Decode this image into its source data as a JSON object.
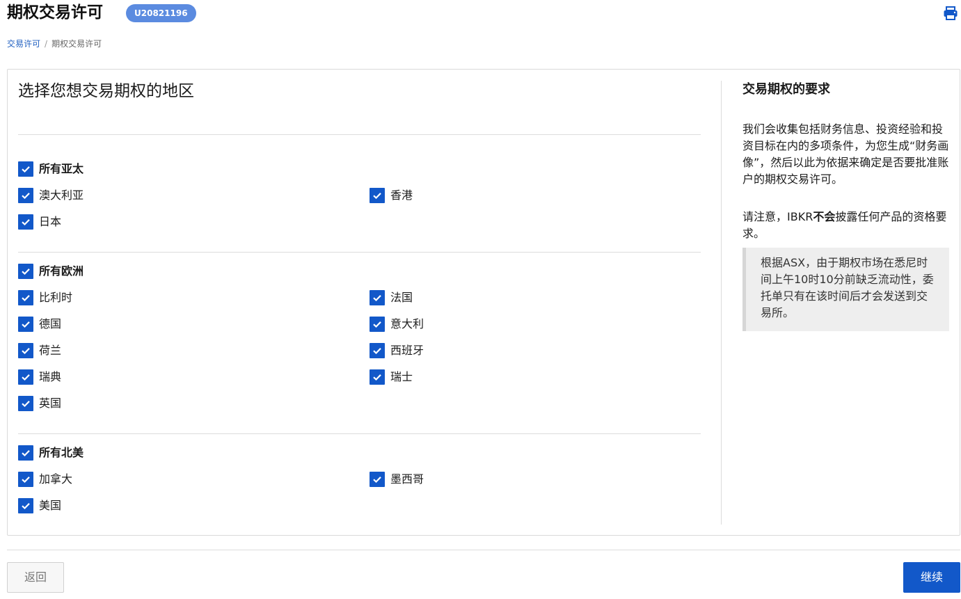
{
  "header": {
    "title": "期权交易许可",
    "account_id": "U20821196",
    "print_icon": "printer-icon"
  },
  "breadcrumb": {
    "parent": "交易许可",
    "separator": "/",
    "current": "期权交易许可"
  },
  "main": {
    "section_title": "选择您想交易期权的地区",
    "regions": [
      {
        "label": "所有亚太",
        "checked": true,
        "countries": [
          {
            "label": "澳大利亚",
            "checked": true
          },
          {
            "label": "香港",
            "checked": true
          },
          {
            "label": "日本",
            "checked": true
          }
        ]
      },
      {
        "label": "所有欧洲",
        "checked": true,
        "countries": [
          {
            "label": "比利时",
            "checked": true
          },
          {
            "label": "法国",
            "checked": true
          },
          {
            "label": "德国",
            "checked": true
          },
          {
            "label": "意大利",
            "checked": true
          },
          {
            "label": "荷兰",
            "checked": true
          },
          {
            "label": "西班牙",
            "checked": true
          },
          {
            "label": "瑞典",
            "checked": true
          },
          {
            "label": "瑞士",
            "checked": true
          },
          {
            "label": "英国",
            "checked": true
          }
        ]
      },
      {
        "label": "所有北美",
        "checked": true,
        "countries": [
          {
            "label": "加拿大",
            "checked": true
          },
          {
            "label": "墨西哥",
            "checked": true
          },
          {
            "label": "美国",
            "checked": true
          }
        ]
      }
    ]
  },
  "requirements": {
    "title": "交易期权的要求",
    "paragraph": "我们会收集包括财务信息、投资经验和投资目标在内的多项条件，为您生成“财务画像”，然后以此为依据来确定是否要批准账户的期权交易许可。",
    "note_prefix": "请注意，IBKR",
    "note_bold": "不会",
    "note_suffix": "披露任何产品的资格要求。",
    "info": "根据ASX，由于期权市场在悉尼时间上午10时10分前缺乏流动性，委托单只有在该时间后才会发送到交易所。"
  },
  "footer": {
    "back_label": "返回",
    "continue_label": "继续"
  },
  "colors": {
    "accent": "#1258c9",
    "badge": "#5b8be0",
    "link": "#1f5fc0"
  }
}
